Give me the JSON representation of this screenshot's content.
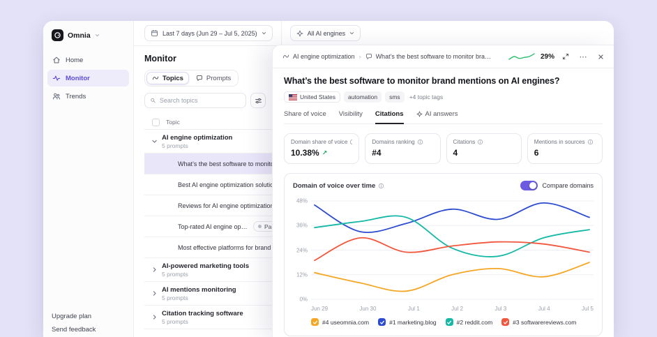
{
  "app": {
    "background": "#e4e2f8",
    "accent": "#6a5be2"
  },
  "sidebar": {
    "brand": "Omnia",
    "items": [
      {
        "label": "Home"
      },
      {
        "label": "Monitor",
        "active": true
      },
      {
        "label": "Trends"
      }
    ],
    "footer": [
      {
        "label": "Upgrade plan"
      },
      {
        "label": "Send feedback"
      }
    ]
  },
  "topbar": {
    "date_filter": "Last 7 days (Jun 29 – Jul 5, 2025)",
    "engine_filter": "All AI engines"
  },
  "monitor": {
    "title": "Monitor",
    "view_tabs": [
      {
        "label": "Topics",
        "active": true
      },
      {
        "label": "Prompts"
      }
    ],
    "search_placeholder": "Search topics",
    "column_header": "Topic",
    "groups": [
      {
        "name": "AI engine optimization",
        "meta": "5 prompts",
        "expanded": true
      },
      {
        "name": "AI-powered marketing tools",
        "meta": "5 prompts",
        "expanded": false
      },
      {
        "name": "AI mentions monitoring",
        "meta": "5 prompts",
        "expanded": false
      },
      {
        "name": "Citation tracking software",
        "meta": "5 prompts",
        "expanded": false
      }
    ],
    "prompts": [
      {
        "label": "What’s the best software to monitor brand mentions on AI engines?",
        "selected": true
      },
      {
        "label": "Best AI engine optimization solutions for startups"
      },
      {
        "label": "Reviews for AI engine optimization tools"
      },
      {
        "label": "Top-rated AI engine optimization tools",
        "badge": "Paused"
      },
      {
        "label": "Most effective platforms for brand visibility"
      }
    ]
  },
  "panel": {
    "breadcrumb": {
      "topic": "AI engine optimization",
      "prompt": "What’s the best software to monitor brand...",
      "score": "29%",
      "sparkline": [
        23,
        26,
        24,
        25,
        26,
        29
      ]
    },
    "title": "What’s the best software to monitor brand mentions on AI engines?",
    "tags": {
      "country": "United States",
      "pills": [
        "automation",
        "sms"
      ],
      "more": "+4 topic tags"
    },
    "tabs": [
      {
        "label": "Share of voice"
      },
      {
        "label": "Visibility"
      },
      {
        "label": "Citations",
        "active": true
      },
      {
        "label": "AI answers"
      }
    ],
    "stats": [
      {
        "label": "Domain share of voice",
        "value": "10.38%",
        "trend": "up"
      },
      {
        "label": "Domains ranking",
        "value": "#4"
      },
      {
        "label": "Citations",
        "value": "4"
      },
      {
        "label": "Mentions in sources",
        "value": "6"
      }
    ],
    "chart_card": {
      "title": "Domain of voice over time",
      "toggle_label": "Compare domains",
      "toggle_on": true
    }
  },
  "chart_data": {
    "type": "line",
    "title": "Domain of voice over time",
    "x": [
      "Jun 29",
      "Jun 30",
      "Jul 1",
      "Jul 2",
      "Jul 3",
      "Jul 4",
      "Jul 5"
    ],
    "ylim": [
      0,
      48
    ],
    "yticks": [
      0,
      12,
      24,
      36,
      48
    ],
    "ytick_labels": [
      "0%",
      "12%",
      "24%",
      "36%",
      "48%"
    ],
    "grid": true,
    "legend_position": "bottom",
    "series": [
      {
        "name": "#1 marketing.blog",
        "color": "#2b4bd0",
        "values": [
          46,
          33,
          37,
          44,
          39,
          47,
          40
        ]
      },
      {
        "name": "#2 reddit.com",
        "color": "#14b8a6",
        "values": [
          35,
          38,
          40,
          25,
          21,
          30,
          34
        ]
      },
      {
        "name": "#3 softwarereviews.com",
        "color": "#f2573d",
        "values": [
          19,
          30,
          23,
          26,
          28,
          27,
          23
        ]
      },
      {
        "name": "#4 useomnia.com",
        "color": "#f5a623",
        "values": [
          13,
          8,
          4,
          12,
          15,
          11,
          18
        ]
      }
    ],
    "legend": [
      {
        "label": "#4 useomnia.com",
        "color": "#f5a623"
      },
      {
        "label": "#1 marketing.blog",
        "color": "#2b4bd0"
      },
      {
        "label": "#2 reddit.com",
        "color": "#14b8a6"
      },
      {
        "label": "#3 softwarereviews.com",
        "color": "#f2573d"
      }
    ]
  }
}
